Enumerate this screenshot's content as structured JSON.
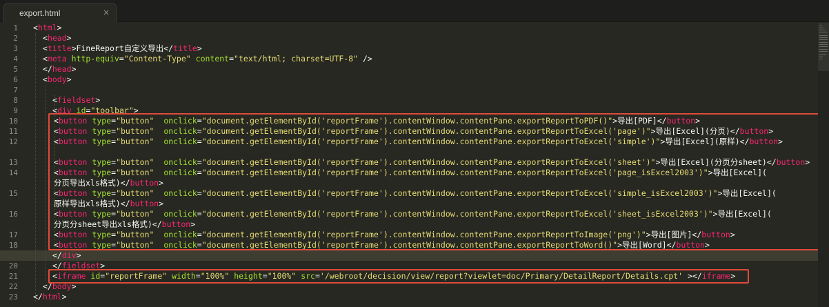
{
  "window": {
    "tab": {
      "title": "export.html",
      "close_glyph": "×"
    }
  },
  "editor": {
    "active_line": 19,
    "lines": [
      {
        "num": "1"
      },
      {
        "num": "2"
      },
      {
        "num": "3"
      },
      {
        "num": "4"
      },
      {
        "num": "5"
      },
      {
        "num": "6"
      },
      {
        "num": "7"
      },
      {
        "num": "8"
      },
      {
        "num": "9"
      },
      {
        "num": "10"
      },
      {
        "num": "11"
      },
      {
        "num": "12"
      },
      {
        "num": "13"
      },
      {
        "num": "14"
      },
      {
        "num": "15"
      },
      {
        "num": "16"
      },
      {
        "num": "17"
      },
      {
        "num": "18"
      },
      {
        "num": "19"
      },
      {
        "num": "20"
      },
      {
        "num": "21"
      },
      {
        "num": "22"
      },
      {
        "num": "23"
      }
    ],
    "code": {
      "l1_tag": "html",
      "l2_tag": "head",
      "l3_tag": "title",
      "l3_text": "FineReport自定义导出",
      "l4_tag": "meta",
      "l4_attr1": "http-equiv",
      "l4_val1": "\"Content-Type\"",
      "l4_attr2": "content",
      "l4_val2": "\"text/html; charset=UTF-8\"",
      "l4_end": " />",
      "l5_tag": "head",
      "l6_tag": "body",
      "l8_tag": "fieldset",
      "l9_tag": "div",
      "l9_attr": "id",
      "l9_val": "\"toolbar\"",
      "btn_tag": "button",
      "type_attr": "type",
      "type_val": "\"button\"",
      "onclick_attr": "onclick",
      "l10_js": "\"document.getElementById('reportFrame').contentWindow.contentPane.exportReportToPDF()\"",
      "l10_text": "导出[PDF]",
      "l11_js": "\"document.getElementById('reportFrame').contentWindow.contentPane.exportReportToExcel('page')\"",
      "l11_text": "导出[Excel](分页)",
      "l12_js": "\"document.getElementById('reportFrame').contentWindow.contentPane.exportReportToExcel('simple')\"",
      "l12_text": "导出[Excel](原样)",
      "l13_js": "\"document.getElementById('reportFrame').contentWindow.contentPane.exportReportToExcel('sheet')\"",
      "l13_text": "导出[Excel](分页分sheet)",
      "l14_js": "\"document.getElementById('reportFrame').contentWindow.contentPane.exportReportToExcel('page_isExcel2003')\"",
      "l14_text": "导出[Excel](",
      "l14_wrap": "分页导出xls格式)",
      "l15_js": "\"document.getElementById('reportFrame').contentWindow.contentPane.exportReportToExcel('simple_isExcel2003')\"",
      "l15_text": "导出[Excel](",
      "l15_wrap": "原样导出xls格式)",
      "l16_js": "\"document.getElementById('reportFrame').contentWindow.contentPane.exportReportToExcel('sheet_isExcel2003')\"",
      "l16_text": "导出[Excel](",
      "l16_wrap": "分页分sheet导出xls格式)",
      "l17_js": "\"document.getElementById('reportFrame').contentWindow.contentPane.exportReportToImage('png')\"",
      "l17_text": "导出[图片]",
      "l18_js": "\"document.getElementById('reportFrame').contentWindow.contentPane.exportReportToWord()\"",
      "l18_text": "导出[Word]",
      "l19_tag": "div",
      "l20_tag": "fieldset",
      "l21_tag": "iframe",
      "l21_attr_id": "id",
      "l21_val_id": "\"reportFrame\"",
      "l21_attr_w": "width",
      "l21_val_w": "\"100%\"",
      "l21_attr_h": "height",
      "l21_val_h": "\"100%\"",
      "l21_attr_src": "src",
      "l21_val_src": "'/webroot/decision/view/report?viewlet=doc/Primary/DetailReport/Details.cpt'",
      "l22_tag": "body",
      "l23_tag": "html"
    }
  },
  "colors": {
    "background": "#272822",
    "tag": "#f92672",
    "attribute": "#a6e22e",
    "string": "#e6db74",
    "highlight_box": "#e04a3a"
  }
}
